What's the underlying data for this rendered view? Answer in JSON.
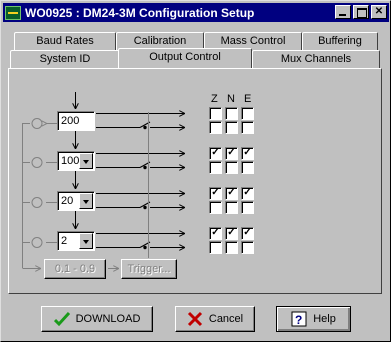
{
  "window": {
    "title": "WO0925 : DM24-3M Configuration Setup"
  },
  "tabs": {
    "back_row": [
      "Baud Rates",
      "Calibration",
      "Mass Control",
      "Buffering"
    ],
    "front_row": [
      "System ID",
      "Output Control",
      "Mux Channels"
    ],
    "active": "Output Control"
  },
  "columns": {
    "z": "Z",
    "n": "N",
    "e": "E"
  },
  "stages": [
    {
      "value": "200",
      "type": "text",
      "checks_top": [
        false,
        false,
        false
      ],
      "checks_bottom": [
        false,
        false,
        false
      ]
    },
    {
      "value": "100",
      "type": "combo",
      "checks_top": [
        true,
        true,
        true
      ],
      "checks_bottom": [
        false,
        false,
        false
      ]
    },
    {
      "value": "20",
      "type": "combo",
      "checks_top": [
        true,
        true,
        true
      ],
      "checks_bottom": [
        false,
        false,
        false
      ]
    },
    {
      "value": "2",
      "type": "combo",
      "checks_top": [
        true,
        true,
        true
      ],
      "checks_bottom": [
        false,
        false,
        false
      ]
    }
  ],
  "filter_buttons": {
    "range": "0.1 - 0.9",
    "trigger": "Trigger..."
  },
  "actions": {
    "download": "DOWNLOAD",
    "cancel": "Cancel",
    "help": "Help"
  },
  "colors": {
    "titlebar": "#000080",
    "download_icon": "#1a9a1a",
    "cancel_icon": "#c00000"
  }
}
